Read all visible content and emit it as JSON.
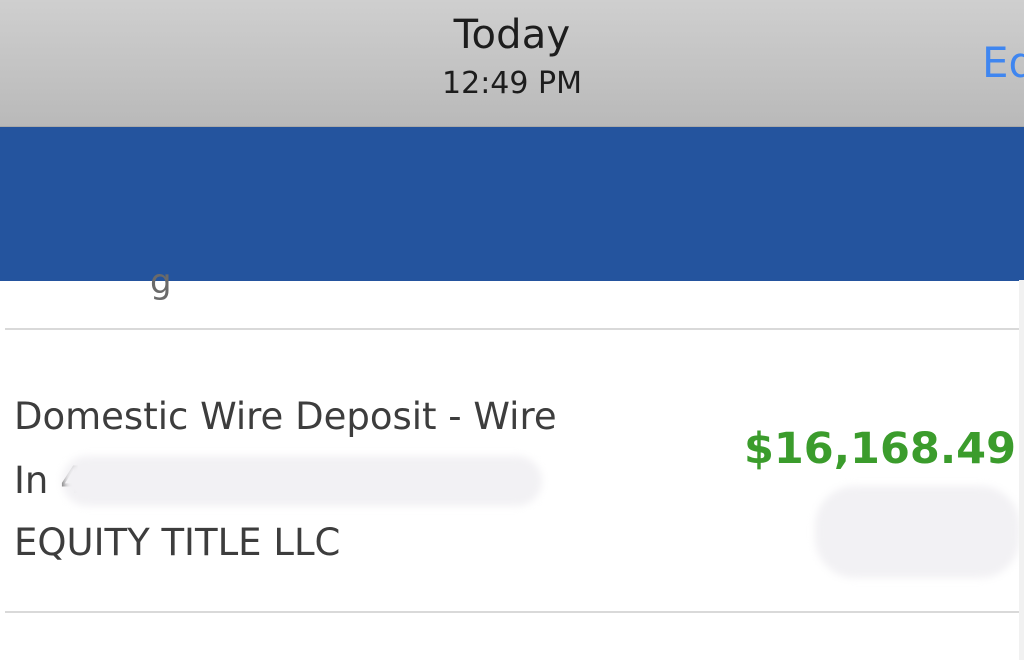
{
  "header": {
    "title": "Today",
    "time": "12:49 PM",
    "edit_label": "Ed"
  },
  "section": {
    "cutoff_label": "g"
  },
  "transaction": {
    "description": "Domestic Wire Deposit - Wire",
    "account_line": "In 4",
    "payee": "EQUITY TITLE LLC",
    "amount": "$16,168.49",
    "amount_color": "#3b9c2c"
  },
  "colors": {
    "header_bg": "#c4c4c4",
    "app_bar": "#24549e",
    "link": "#3f86f0"
  },
  "icons": {
    "settings": "gear-icon"
  }
}
